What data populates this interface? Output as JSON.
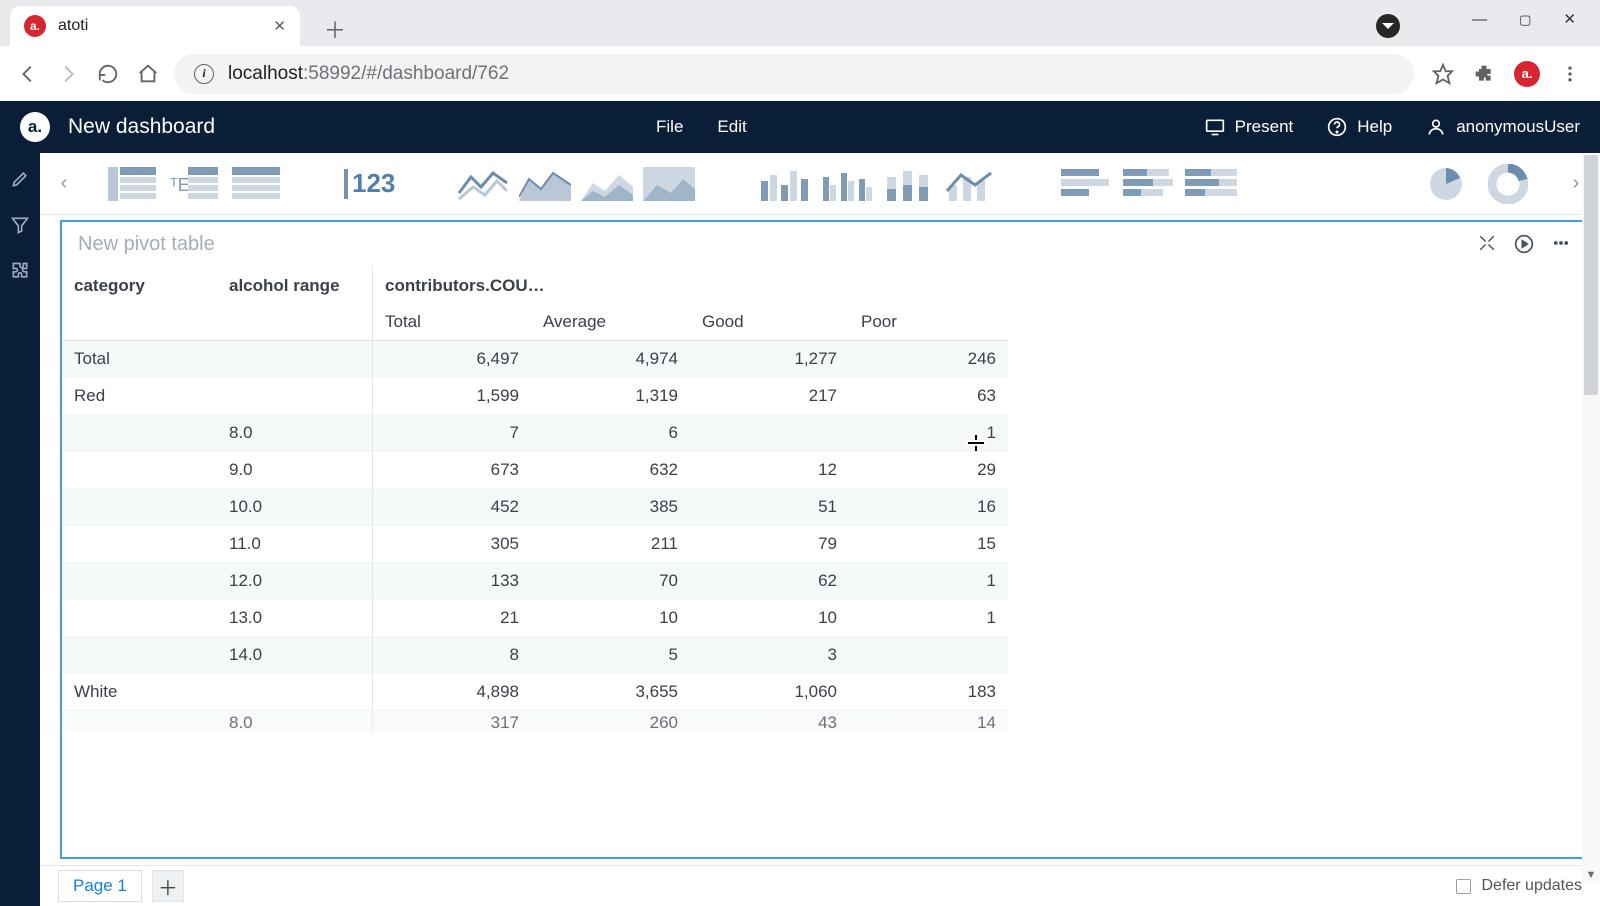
{
  "browser": {
    "tab_title": "atoti",
    "url_host": "localhost",
    "url_port_path": ":58992/#/dashboard/762"
  },
  "app": {
    "dashboard_title": "New dashboard",
    "menu_file": "File",
    "menu_edit": "Edit",
    "action_present": "Present",
    "action_help": "Help",
    "user": "anonymousUser"
  },
  "widget": {
    "title": "New pivot table",
    "row_headers": [
      "category",
      "alcohol range"
    ],
    "measure_header": "contributors.COU…",
    "column_headers": [
      "Total",
      "Average",
      "Good",
      "Poor"
    ],
    "rows": [
      {
        "cat": "Total",
        "sub": "",
        "vals": [
          "6,497",
          "4,974",
          "1,277",
          "246"
        ]
      },
      {
        "cat": "Red",
        "sub": "",
        "vals": [
          "1,599",
          "1,319",
          "217",
          "63"
        ]
      },
      {
        "cat": "",
        "sub": "8.0",
        "vals": [
          "7",
          "6",
          "",
          "1"
        ]
      },
      {
        "cat": "",
        "sub": "9.0",
        "vals": [
          "673",
          "632",
          "12",
          "29"
        ]
      },
      {
        "cat": "",
        "sub": "10.0",
        "vals": [
          "452",
          "385",
          "51",
          "16"
        ]
      },
      {
        "cat": "",
        "sub": "11.0",
        "vals": [
          "305",
          "211",
          "79",
          "15"
        ]
      },
      {
        "cat": "",
        "sub": "12.0",
        "vals": [
          "133",
          "70",
          "62",
          "1"
        ]
      },
      {
        "cat": "",
        "sub": "13.0",
        "vals": [
          "21",
          "10",
          "10",
          "1"
        ]
      },
      {
        "cat": "",
        "sub": "14.0",
        "vals": [
          "8",
          "5",
          "3",
          ""
        ]
      },
      {
        "cat": "White",
        "sub": "",
        "vals": [
          "4,898",
          "3,655",
          "1,060",
          "183"
        ]
      },
      {
        "cat": "",
        "sub": "8.0",
        "vals": [
          "317",
          "260",
          "43",
          "14"
        ]
      }
    ]
  },
  "footer": {
    "page_tab": "Page 1",
    "defer_label": "Defer updates"
  }
}
